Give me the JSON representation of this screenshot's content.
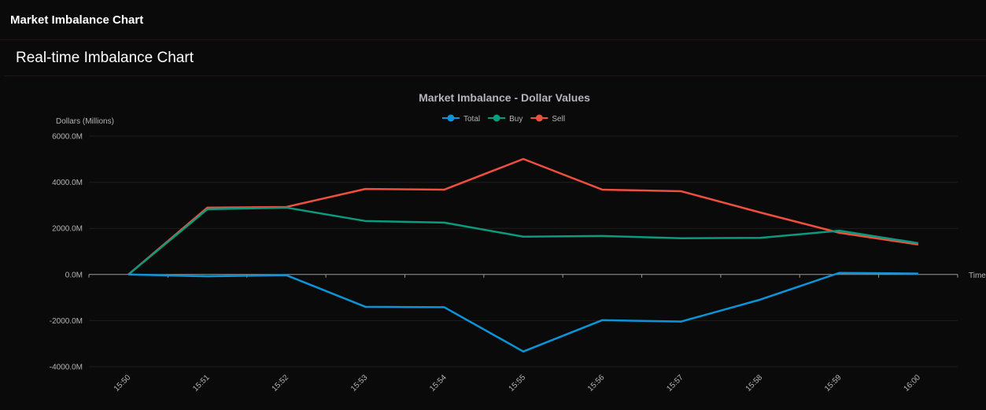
{
  "app": {
    "title": "Market Imbalance Chart"
  },
  "card": {
    "title": "Real-time Imbalance Chart"
  },
  "chart_data": {
    "type": "line",
    "title": "Market Imbalance - Dollar Values",
    "xlabel": "Time",
    "ylabel": "Dollars (Millions)",
    "categories": [
      "15:50",
      "15:51",
      "15:52",
      "15:53",
      "15:54",
      "15:55",
      "15:56",
      "15:57",
      "15:58",
      "15:59",
      "16:00"
    ],
    "ylim": [
      -4000,
      6000
    ],
    "yticks": [
      6000,
      4000,
      2000,
      0,
      -2000,
      -4000
    ],
    "ytick_labels": [
      "6000.0M",
      "4000.0M",
      "2000.0M",
      "0.0M",
      "-2000.0M",
      "-4000.0M"
    ],
    "grid": true,
    "legend": "top-center",
    "series": [
      {
        "name": "Total",
        "color": "#0b95d8",
        "values": [
          0,
          -80,
          -30,
          -1400,
          -1420,
          -3340,
          -1980,
          -2040,
          -1090,
          70,
          40
        ]
      },
      {
        "name": "Buy",
        "color": "#0a9a7c",
        "values": [
          0,
          2830,
          2900,
          2320,
          2250,
          1640,
          1670,
          1570,
          1590,
          1900,
          1360
        ]
      },
      {
        "name": "Sell",
        "color": "#f04f3f",
        "values": [
          0,
          2900,
          2930,
          3710,
          3680,
          5010,
          3680,
          3610,
          2690,
          1810,
          1300
        ]
      }
    ]
  }
}
